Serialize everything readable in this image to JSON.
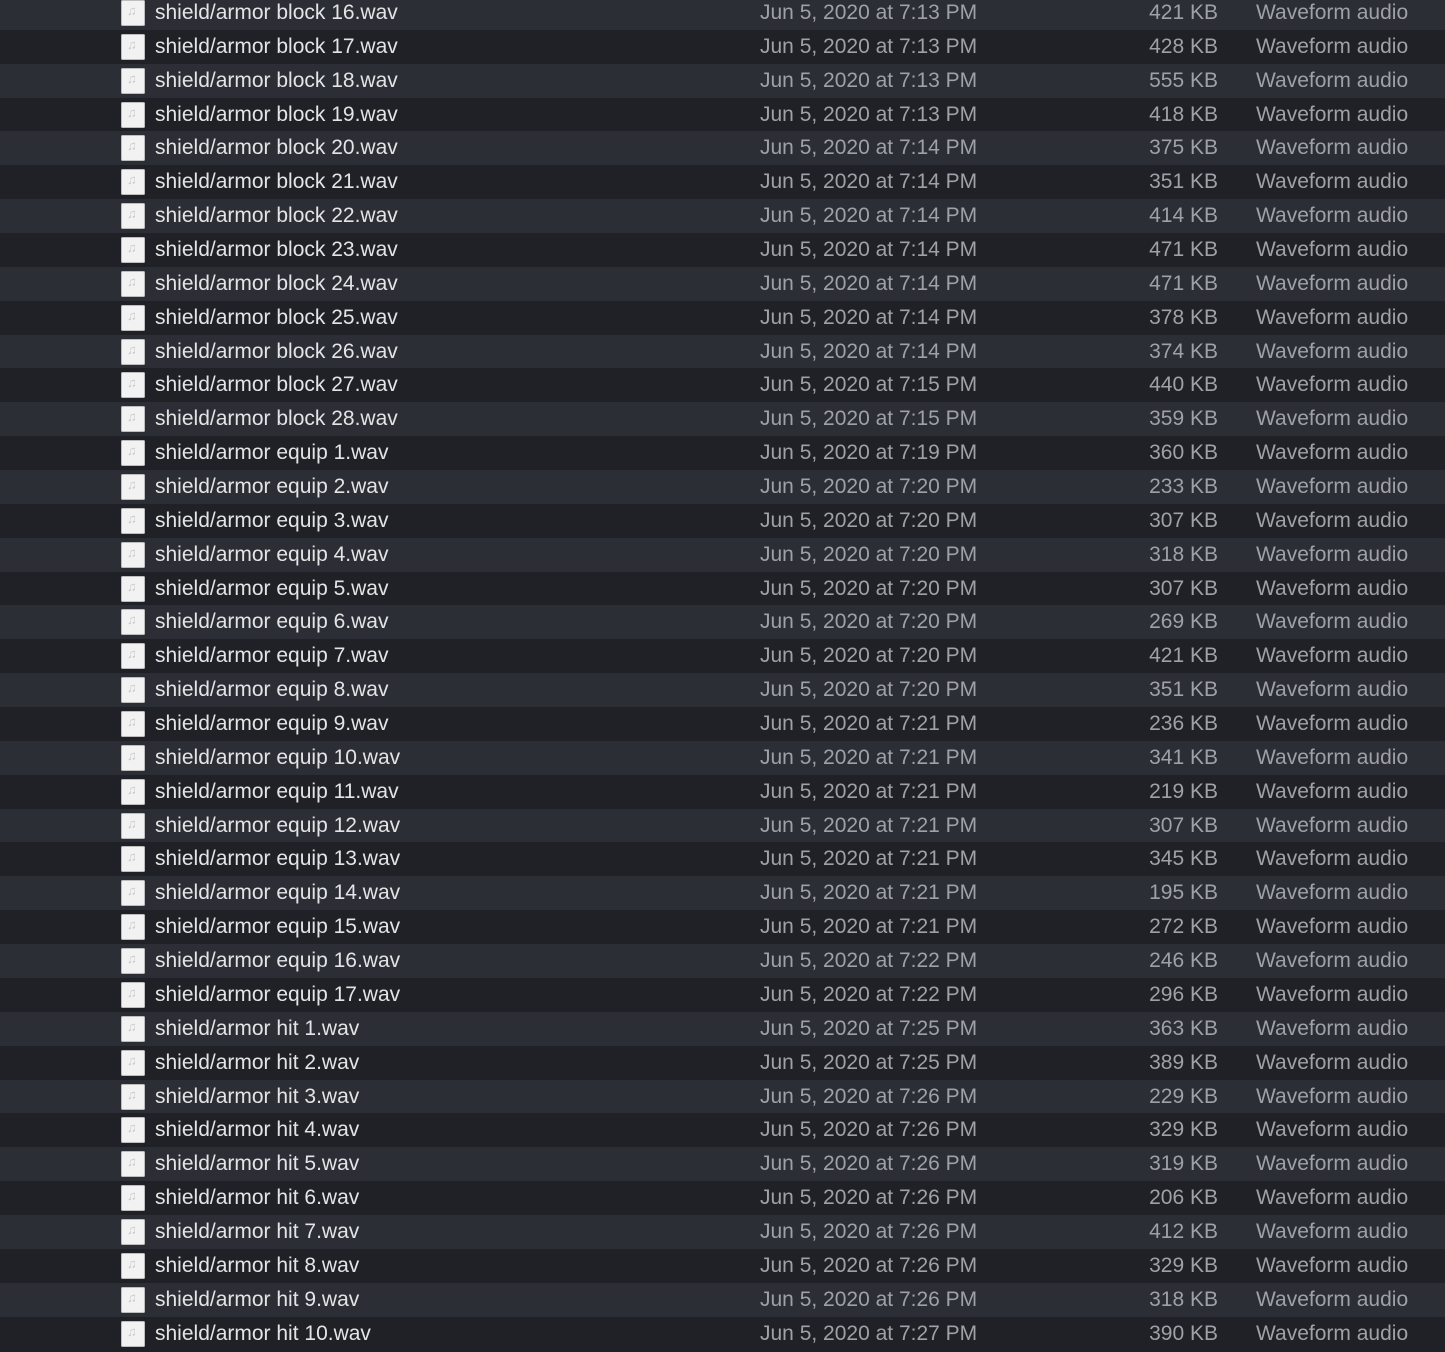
{
  "colors": {
    "row_light": "#2b2e34",
    "row_dark": "#1f2126",
    "name_text": "#e3e4e6",
    "meta_text": "#9ea1a7"
  },
  "file_icon": "audio-file-icon",
  "files": [
    {
      "name": "shield/armor block 16.wav",
      "date": "Jun 5, 2020 at 7:13 PM",
      "size": "421 KB",
      "kind": "Waveform audio"
    },
    {
      "name": "shield/armor block 17.wav",
      "date": "Jun 5, 2020 at 7:13 PM",
      "size": "428 KB",
      "kind": "Waveform audio"
    },
    {
      "name": "shield/armor block 18.wav",
      "date": "Jun 5, 2020 at 7:13 PM",
      "size": "555 KB",
      "kind": "Waveform audio"
    },
    {
      "name": "shield/armor block 19.wav",
      "date": "Jun 5, 2020 at 7:13 PM",
      "size": "418 KB",
      "kind": "Waveform audio"
    },
    {
      "name": "shield/armor block 20.wav",
      "date": "Jun 5, 2020 at 7:14 PM",
      "size": "375 KB",
      "kind": "Waveform audio"
    },
    {
      "name": "shield/armor block 21.wav",
      "date": "Jun 5, 2020 at 7:14 PM",
      "size": "351 KB",
      "kind": "Waveform audio"
    },
    {
      "name": "shield/armor block 22.wav",
      "date": "Jun 5, 2020 at 7:14 PM",
      "size": "414 KB",
      "kind": "Waveform audio"
    },
    {
      "name": "shield/armor block 23.wav",
      "date": "Jun 5, 2020 at 7:14 PM",
      "size": "471 KB",
      "kind": "Waveform audio"
    },
    {
      "name": "shield/armor block 24.wav",
      "date": "Jun 5, 2020 at 7:14 PM",
      "size": "471 KB",
      "kind": "Waveform audio"
    },
    {
      "name": "shield/armor block 25.wav",
      "date": "Jun 5, 2020 at 7:14 PM",
      "size": "378 KB",
      "kind": "Waveform audio"
    },
    {
      "name": "shield/armor block 26.wav",
      "date": "Jun 5, 2020 at 7:14 PM",
      "size": "374 KB",
      "kind": "Waveform audio"
    },
    {
      "name": "shield/armor block 27.wav",
      "date": "Jun 5, 2020 at 7:15 PM",
      "size": "440 KB",
      "kind": "Waveform audio"
    },
    {
      "name": "shield/armor block 28.wav",
      "date": "Jun 5, 2020 at 7:15 PM",
      "size": "359 KB",
      "kind": "Waveform audio"
    },
    {
      "name": "shield/armor equip 1.wav",
      "date": "Jun 5, 2020 at 7:19 PM",
      "size": "360 KB",
      "kind": "Waveform audio"
    },
    {
      "name": "shield/armor equip 2.wav",
      "date": "Jun 5, 2020 at 7:20 PM",
      "size": "233 KB",
      "kind": "Waveform audio"
    },
    {
      "name": "shield/armor equip 3.wav",
      "date": "Jun 5, 2020 at 7:20 PM",
      "size": "307 KB",
      "kind": "Waveform audio"
    },
    {
      "name": "shield/armor equip 4.wav",
      "date": "Jun 5, 2020 at 7:20 PM",
      "size": "318 KB",
      "kind": "Waveform audio"
    },
    {
      "name": "shield/armor equip 5.wav",
      "date": "Jun 5, 2020 at 7:20 PM",
      "size": "307 KB",
      "kind": "Waveform audio"
    },
    {
      "name": "shield/armor equip 6.wav",
      "date": "Jun 5, 2020 at 7:20 PM",
      "size": "269 KB",
      "kind": "Waveform audio"
    },
    {
      "name": "shield/armor equip 7.wav",
      "date": "Jun 5, 2020 at 7:20 PM",
      "size": "421 KB",
      "kind": "Waveform audio"
    },
    {
      "name": "shield/armor equip 8.wav",
      "date": "Jun 5, 2020 at 7:20 PM",
      "size": "351 KB",
      "kind": "Waveform audio"
    },
    {
      "name": "shield/armor equip 9.wav",
      "date": "Jun 5, 2020 at 7:21 PM",
      "size": "236 KB",
      "kind": "Waveform audio"
    },
    {
      "name": "shield/armor equip 10.wav",
      "date": "Jun 5, 2020 at 7:21 PM",
      "size": "341 KB",
      "kind": "Waveform audio"
    },
    {
      "name": "shield/armor equip 11.wav",
      "date": "Jun 5, 2020 at 7:21 PM",
      "size": "219 KB",
      "kind": "Waveform audio"
    },
    {
      "name": "shield/armor equip 12.wav",
      "date": "Jun 5, 2020 at 7:21 PM",
      "size": "307 KB",
      "kind": "Waveform audio"
    },
    {
      "name": "shield/armor equip 13.wav",
      "date": "Jun 5, 2020 at 7:21 PM",
      "size": "345 KB",
      "kind": "Waveform audio"
    },
    {
      "name": "shield/armor equip 14.wav",
      "date": "Jun 5, 2020 at 7:21 PM",
      "size": "195 KB",
      "kind": "Waveform audio"
    },
    {
      "name": "shield/armor equip 15.wav",
      "date": "Jun 5, 2020 at 7:21 PM",
      "size": "272 KB",
      "kind": "Waveform audio"
    },
    {
      "name": "shield/armor equip 16.wav",
      "date": "Jun 5, 2020 at 7:22 PM",
      "size": "246 KB",
      "kind": "Waveform audio"
    },
    {
      "name": "shield/armor equip 17.wav",
      "date": "Jun 5, 2020 at 7:22 PM",
      "size": "296 KB",
      "kind": "Waveform audio"
    },
    {
      "name": "shield/armor hit 1.wav",
      "date": "Jun 5, 2020 at 7:25 PM",
      "size": "363 KB",
      "kind": "Waveform audio"
    },
    {
      "name": "shield/armor hit 2.wav",
      "date": "Jun 5, 2020 at 7:25 PM",
      "size": "389 KB",
      "kind": "Waveform audio"
    },
    {
      "name": "shield/armor hit 3.wav",
      "date": "Jun 5, 2020 at 7:26 PM",
      "size": "229 KB",
      "kind": "Waveform audio"
    },
    {
      "name": "shield/armor hit 4.wav",
      "date": "Jun 5, 2020 at 7:26 PM",
      "size": "329 KB",
      "kind": "Waveform audio"
    },
    {
      "name": "shield/armor hit 5.wav",
      "date": "Jun 5, 2020 at 7:26 PM",
      "size": "319 KB",
      "kind": "Waveform audio"
    },
    {
      "name": "shield/armor hit 6.wav",
      "date": "Jun 5, 2020 at 7:26 PM",
      "size": "206 KB",
      "kind": "Waveform audio"
    },
    {
      "name": "shield/armor hit 7.wav",
      "date": "Jun 5, 2020 at 7:26 PM",
      "size": "412 KB",
      "kind": "Waveform audio"
    },
    {
      "name": "shield/armor hit 8.wav",
      "date": "Jun 5, 2020 at 7:26 PM",
      "size": "329 KB",
      "kind": "Waveform audio"
    },
    {
      "name": "shield/armor hit 9.wav",
      "date": "Jun 5, 2020 at 7:26 PM",
      "size": "318 KB",
      "kind": "Waveform audio"
    },
    {
      "name": "shield/armor hit 10.wav",
      "date": "Jun 5, 2020 at 7:27 PM",
      "size": "390 KB",
      "kind": "Waveform audio"
    }
  ]
}
